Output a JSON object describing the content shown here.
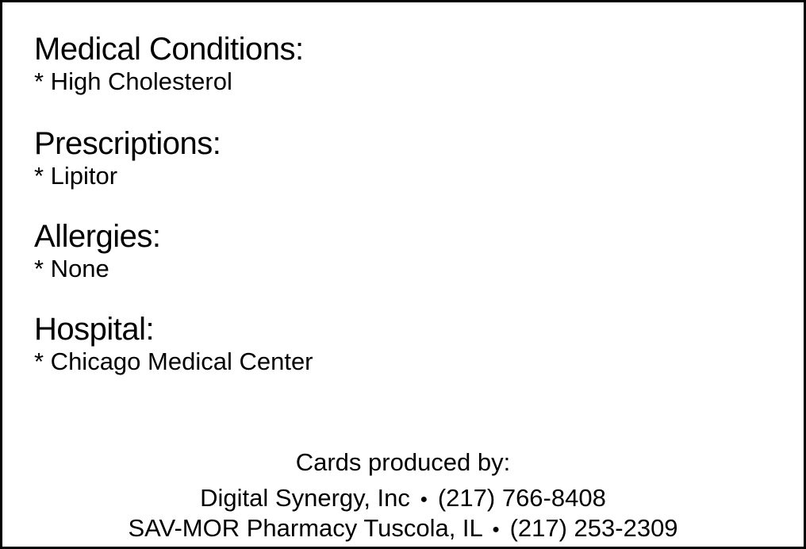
{
  "sections": [
    {
      "heading": "Medical Conditions:",
      "item": "* High Cholesterol"
    },
    {
      "heading": "Prescriptions:",
      "item": "* Lipitor"
    },
    {
      "heading": "Allergies:",
      "item": "* None"
    },
    {
      "heading": "Hospital:",
      "item": "* Chicago Medical Center"
    }
  ],
  "footer": {
    "title": "Cards produced by:",
    "producer_name": "Digital Synergy, Inc",
    "producer_phone": "(217) 766-8408",
    "pharmacy_name": "SAV-MOR Pharmacy Tuscola, IL",
    "pharmacy_phone": "(217) 253-2309",
    "separator": "●"
  }
}
